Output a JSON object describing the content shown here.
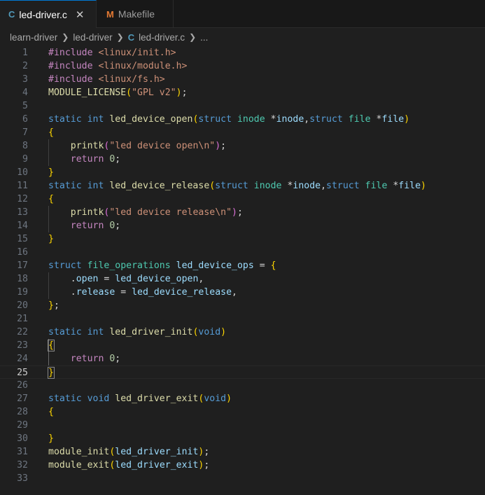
{
  "tabs": [
    {
      "icon": "C",
      "label": "led-driver.c",
      "close": "✕"
    },
    {
      "icon": "M",
      "label": "Makefile"
    }
  ],
  "breadcrumb": {
    "items": [
      "learn-driver",
      "led-driver",
      "led-driver.c",
      "..."
    ],
    "file_icon": "C"
  },
  "editor": {
    "current_line": 25,
    "lines": [
      {
        "n": "1",
        "t": [
          [
            "#include ",
            "pp"
          ],
          [
            "<linux/init.h>",
            "inc"
          ]
        ]
      },
      {
        "n": "2",
        "t": [
          [
            "#include ",
            "pp"
          ],
          [
            "<linux/module.h>",
            "inc"
          ]
        ]
      },
      {
        "n": "3",
        "t": [
          [
            "#include ",
            "pp"
          ],
          [
            "<linux/fs.h>",
            "inc"
          ]
        ]
      },
      {
        "n": "4",
        "t": [
          [
            "MODULE_LICENSE",
            "fn"
          ],
          [
            "(",
            "br"
          ],
          [
            "\"GPL v2\"",
            "str"
          ],
          [
            ")",
            "br"
          ],
          [
            ";",
            "pl"
          ]
        ]
      },
      {
        "n": "5",
        "t": []
      },
      {
        "n": "6",
        "t": [
          [
            "static ",
            "kw"
          ],
          [
            "int ",
            "kw"
          ],
          [
            "led_device_open",
            "fn"
          ],
          [
            "(",
            "br"
          ],
          [
            "struct ",
            "kw"
          ],
          [
            "inode ",
            "ty"
          ],
          [
            "*",
            "pl"
          ],
          [
            "inode",
            "var"
          ],
          [
            ",",
            "pl"
          ],
          [
            "struct ",
            "kw"
          ],
          [
            "file ",
            "ty"
          ],
          [
            "*",
            "pl"
          ],
          [
            "file",
            "var"
          ],
          [
            ")",
            "br"
          ]
        ]
      },
      {
        "n": "7",
        "t": [
          [
            "{",
            "br"
          ]
        ]
      },
      {
        "n": "8",
        "t": [
          [
            "    ",
            "pl"
          ],
          [
            "printk",
            "fn"
          ],
          [
            "(",
            "br2"
          ],
          [
            "\"led device open\\n\"",
            "str"
          ],
          [
            ")",
            "br2"
          ],
          [
            ";",
            "pl"
          ]
        ]
      },
      {
        "n": "9",
        "t": [
          [
            "    ",
            "pl"
          ],
          [
            "return ",
            "pp"
          ],
          [
            "0",
            "num"
          ],
          [
            ";",
            "pl"
          ]
        ]
      },
      {
        "n": "10",
        "t": [
          [
            "}",
            "br"
          ]
        ]
      },
      {
        "n": "11",
        "t": [
          [
            "static ",
            "kw"
          ],
          [
            "int ",
            "kw"
          ],
          [
            "led_device_release",
            "fn"
          ],
          [
            "(",
            "br"
          ],
          [
            "struct ",
            "kw"
          ],
          [
            "inode ",
            "ty"
          ],
          [
            "*",
            "pl"
          ],
          [
            "inode",
            "var"
          ],
          [
            ",",
            "pl"
          ],
          [
            "struct ",
            "kw"
          ],
          [
            "file ",
            "ty"
          ],
          [
            "*",
            "pl"
          ],
          [
            "file",
            "var"
          ],
          [
            ")",
            "br"
          ]
        ]
      },
      {
        "n": "12",
        "t": [
          [
            "{",
            "br"
          ]
        ]
      },
      {
        "n": "13",
        "t": [
          [
            "    ",
            "pl"
          ],
          [
            "printk",
            "fn"
          ],
          [
            "(",
            "br2"
          ],
          [
            "\"led device release\\n\"",
            "str"
          ],
          [
            ")",
            "br2"
          ],
          [
            ";",
            "pl"
          ]
        ]
      },
      {
        "n": "14",
        "t": [
          [
            "    ",
            "pl"
          ],
          [
            "return ",
            "pp"
          ],
          [
            "0",
            "num"
          ],
          [
            ";",
            "pl"
          ]
        ]
      },
      {
        "n": "15",
        "t": [
          [
            "}",
            "br"
          ]
        ]
      },
      {
        "n": "16",
        "t": []
      },
      {
        "n": "17",
        "t": [
          [
            "struct ",
            "kw"
          ],
          [
            "file_operations ",
            "ty"
          ],
          [
            "led_device_ops",
            "var"
          ],
          [
            " = ",
            "pl"
          ],
          [
            "{",
            "br"
          ]
        ]
      },
      {
        "n": "18",
        "t": [
          [
            "    .",
            "pl"
          ],
          [
            "open",
            "var"
          ],
          [
            " = ",
            "pl"
          ],
          [
            "led_device_open",
            "var"
          ],
          [
            ",",
            "pl"
          ]
        ]
      },
      {
        "n": "19",
        "t": [
          [
            "    .",
            "pl"
          ],
          [
            "release",
            "var"
          ],
          [
            " = ",
            "pl"
          ],
          [
            "led_device_release",
            "var"
          ],
          [
            ",",
            "pl"
          ]
        ]
      },
      {
        "n": "20",
        "t": [
          [
            "}",
            "br"
          ],
          [
            ";",
            "pl"
          ]
        ]
      },
      {
        "n": "21",
        "t": []
      },
      {
        "n": "22",
        "t": [
          [
            "static ",
            "kw"
          ],
          [
            "int ",
            "kw"
          ],
          [
            "led_driver_init",
            "fn"
          ],
          [
            "(",
            "br"
          ],
          [
            "void",
            "kw"
          ],
          [
            ")",
            "br"
          ]
        ]
      },
      {
        "n": "23",
        "t": [
          [
            "{",
            "br bm"
          ]
        ]
      },
      {
        "n": "24",
        "t": [
          [
            "    ",
            "pl"
          ],
          [
            "return ",
            "pp"
          ],
          [
            "0",
            "num"
          ],
          [
            ";",
            "pl"
          ]
        ]
      },
      {
        "n": "25",
        "t": [
          [
            "}",
            "br bm"
          ]
        ]
      },
      {
        "n": "26",
        "t": []
      },
      {
        "n": "27",
        "t": [
          [
            "static ",
            "kw"
          ],
          [
            "void ",
            "kw"
          ],
          [
            "led_driver_exit",
            "fn"
          ],
          [
            "(",
            "br"
          ],
          [
            "void",
            "kw"
          ],
          [
            ")",
            "br"
          ]
        ]
      },
      {
        "n": "28",
        "t": [
          [
            "{",
            "br"
          ]
        ]
      },
      {
        "n": "29",
        "t": []
      },
      {
        "n": "30",
        "t": [
          [
            "}",
            "br"
          ]
        ]
      },
      {
        "n": "31",
        "t": [
          [
            "module_init",
            "fn"
          ],
          [
            "(",
            "br"
          ],
          [
            "led_driver_init",
            "var"
          ],
          [
            ")",
            "br"
          ],
          [
            ";",
            "pl"
          ]
        ]
      },
      {
        "n": "32",
        "t": [
          [
            "module_exit",
            "fn"
          ],
          [
            "(",
            "br"
          ],
          [
            "led_driver_exit",
            "var"
          ],
          [
            ")",
            "br"
          ],
          [
            ";",
            "pl"
          ]
        ]
      },
      {
        "n": "33",
        "t": []
      }
    ]
  }
}
